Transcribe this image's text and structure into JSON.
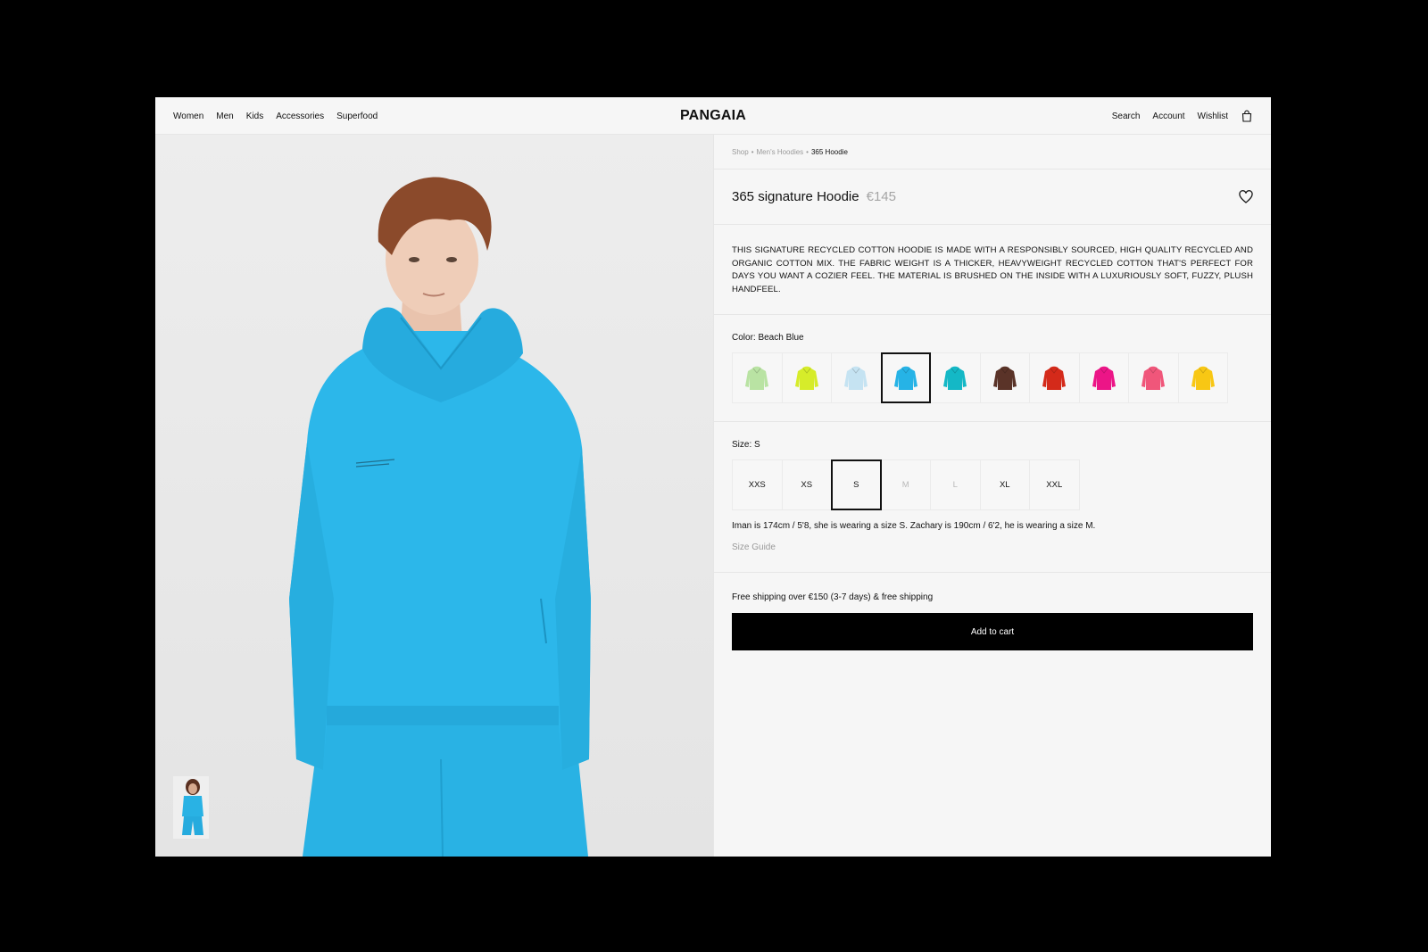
{
  "header": {
    "nav_left": [
      "Women",
      "Men",
      "Kids",
      "Accessories",
      "Superfood"
    ],
    "logo": "PANGAIA",
    "nav_right": [
      "Search",
      "Account",
      "Wishlist"
    ],
    "bag_icon": "shopping-bag-icon"
  },
  "breadcrumb": {
    "items": [
      "Shop",
      "Men's Hoodies"
    ],
    "separator": "•",
    "current": "365 Hoodie"
  },
  "product": {
    "title": "365 signature Hoodie",
    "price": "€145",
    "wishlist_icon": "heart-icon",
    "description": "This signature recycled cotton hoodie is made with a responsibly sourced, high quality recycled and organic cotton mix. The fabric weight is a thicker, heavyweight recycled cotton that's perfect for days you want a cozier feel. The material is brushed on the inside with a luxuriously soft, fuzzy, plush handfeel."
  },
  "color": {
    "label": "Color: Beach Blue",
    "selected_index": 3,
    "swatches": [
      "#b9e3a3",
      "#d6ec2a",
      "#c5e3f2",
      "#26b3e6",
      "#14b8c6",
      "#5a3328",
      "#d42a1a",
      "#ec1587",
      "#f0567a",
      "#f8c714"
    ]
  },
  "size": {
    "label": "Size: S",
    "options": [
      {
        "label": "XXS",
        "state": "available"
      },
      {
        "label": "XS",
        "state": "available"
      },
      {
        "label": "S",
        "state": "selected"
      },
      {
        "label": "M",
        "state": "unavailable"
      },
      {
        "label": "L",
        "state": "unavailable"
      },
      {
        "label": "XL",
        "state": "available"
      },
      {
        "label": "XXL",
        "state": "available"
      }
    ],
    "note": "Iman is 174cm / 5'8, she is wearing a size S. Zachary is 190cm / 6'2, he is wearing a size M.",
    "guide": "Size Guide"
  },
  "cart": {
    "shipping": "Free shipping over €150 (3-7 days) & free shipping",
    "button": "Add to cart"
  },
  "colors": {
    "accent": "#000000",
    "hoodie": "#2bb7ea",
    "background": "#f6f6f6"
  }
}
